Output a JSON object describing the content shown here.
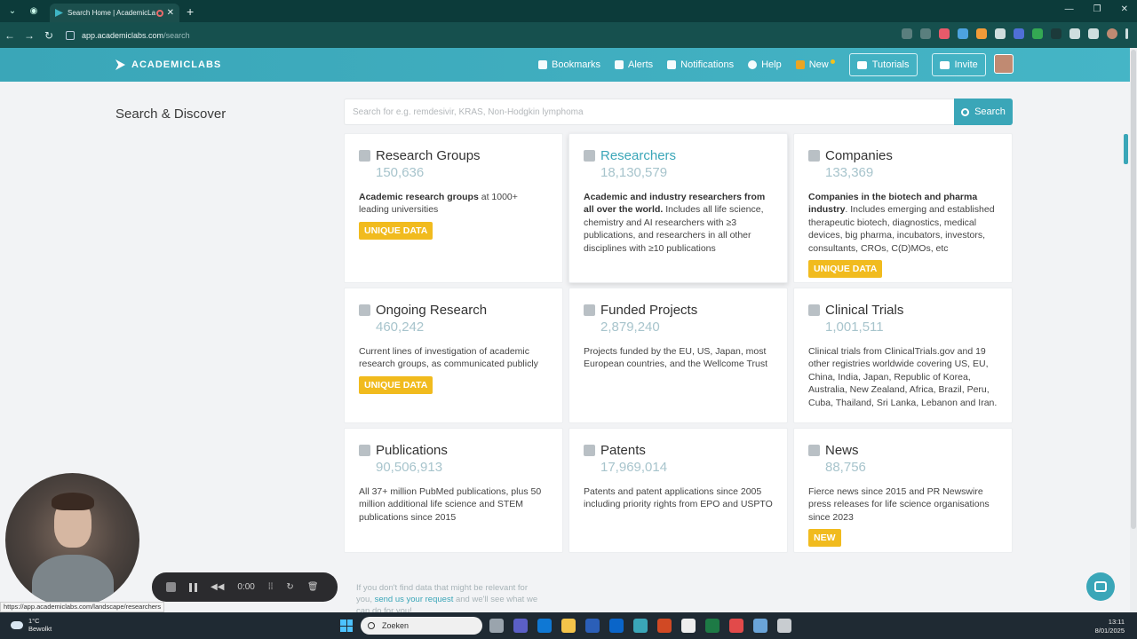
{
  "browser": {
    "tab_title": "Search Home | AcademicLa",
    "url_domain": "app.academiclabs.com",
    "url_path": "/search",
    "status_url": "https://app.academiclabs.com/landscape/researchers"
  },
  "header": {
    "brand": "ACADEMICLABS",
    "nav": {
      "bookmarks": "Bookmarks",
      "alerts": "Alerts",
      "notifications": "Notifications",
      "help": "Help",
      "new": "New",
      "tutorials": "Tutorials",
      "invite": "Invite"
    }
  },
  "search": {
    "page_title": "Search & Discover",
    "placeholder": "Search for e.g. remdesivir, KRAS, Non-Hodgkin lymphoma",
    "button": "Search"
  },
  "cards": [
    {
      "title": "Research Groups",
      "count": "150,636",
      "desc_bold": "Academic research groups",
      "desc": " at 1000+ leading universities",
      "badge": "UNIQUE DATA",
      "icon": "users-icon"
    },
    {
      "title": "Researchers",
      "count": "18,130,579",
      "desc_bold": "Academic and industry researchers from all over the world.",
      "desc": " Includes all life science, chemistry and AI researchers with ≥3 publications, and researchers in all other disciplines with ≥10 publications",
      "badge": "",
      "icon": "person-icon"
    },
    {
      "title": "Companies",
      "count": "133,369",
      "desc_bold": "Companies in the biotech and pharma industry",
      "desc": ". Includes emerging and established therapeutic biotech, diagnostics, medical devices, big pharma, incubators, investors, consultants, CROs, C(D)MOs, etc",
      "badge": "UNIQUE DATA",
      "icon": "building-icon"
    },
    {
      "title": "Ongoing Research",
      "count": "460,242",
      "desc_bold": "",
      "desc": "Current lines of investigation of academic research groups, as communicated publicly",
      "badge": "UNIQUE DATA",
      "icon": "flask-icon"
    },
    {
      "title": "Funded Projects",
      "count": "2,879,240",
      "desc_bold": "",
      "desc": "Projects funded by the EU, US, Japan, most European countries, and the Wellcome Trust",
      "badge": "",
      "icon": "dollar-icon"
    },
    {
      "title": "Clinical Trials",
      "count": "1,001,511",
      "desc_bold": "",
      "desc": "Clinical trials from ClinicalTrials.gov and 19 other registries worldwide covering US, EU, China, India, Japan, Republic of Korea, Australia, New Zealand, Africa, Brazil, Peru, Cuba, Thailand, Sri Lanka, Lebanon and Iran.",
      "badge": "",
      "icon": "stethoscope-icon"
    },
    {
      "title": "Publications",
      "count": "90,506,913",
      "desc_bold": "",
      "desc": "All 37+ million PubMed publications, plus 50 million additional life science and STEM publications since 2015",
      "badge": "",
      "icon": "document-icon"
    },
    {
      "title": "Patents",
      "count": "17,969,014",
      "desc_bold": "",
      "desc": "Patents and patent applications since 2005 including priority rights from EPO and USPTO",
      "badge": "",
      "icon": "lightbulb-icon"
    },
    {
      "title": "News",
      "count": "88,756",
      "desc_bold": "",
      "desc": "Fierce news since 2015 and PR Newswire press releases for life science organisations since 2023",
      "badge": "NEW",
      "icon": "newspaper-icon"
    }
  ],
  "footer": {
    "line1": "If you don't find data that might be relevant for",
    "line2_pre": "you, ",
    "link": "send us your request",
    "line2_post": " and we'll see what we",
    "line3": "can do for you!"
  },
  "recorder": {
    "time": "0:00"
  },
  "taskbar": {
    "temperature": "1°C",
    "weather": "Bewolkt",
    "search": "Zoeken",
    "time": "13:11",
    "date": "8/01/2025"
  },
  "colors": {
    "accent": "#3aa6b8",
    "badge": "#f1bb1e",
    "count": "#a7c4cc"
  }
}
